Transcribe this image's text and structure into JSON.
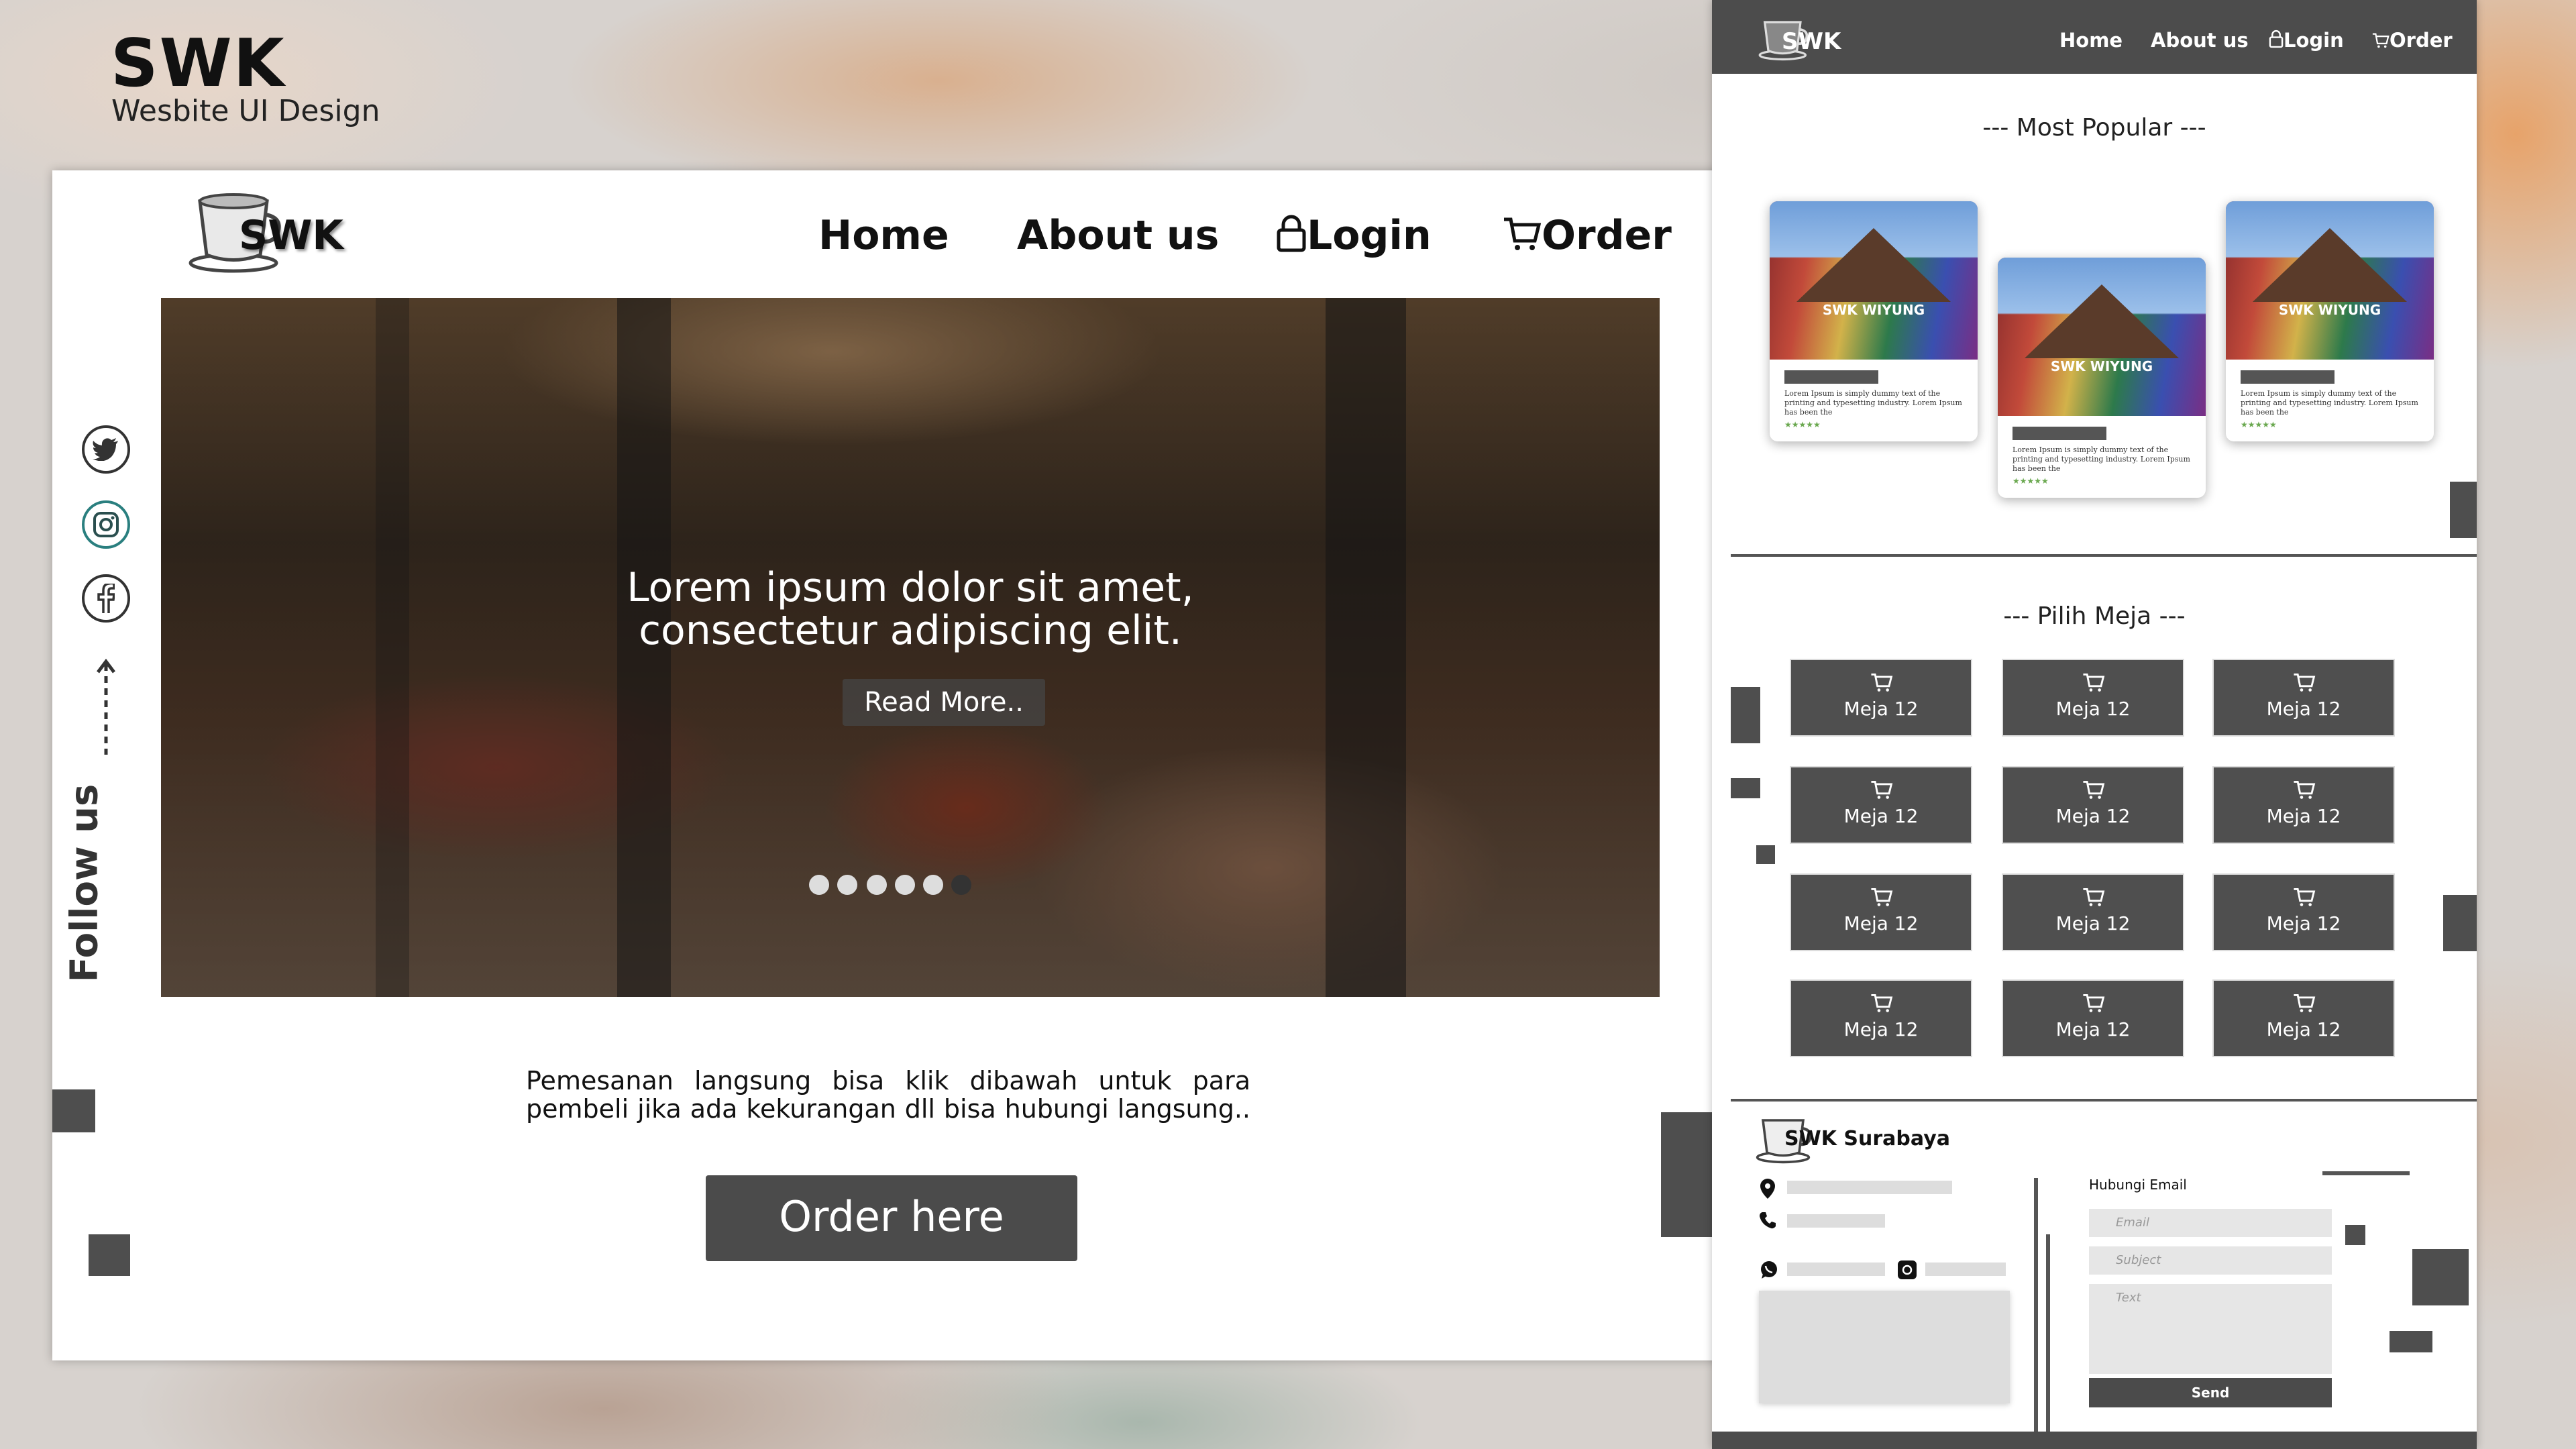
{
  "heading": {
    "title": "SWK",
    "subtitle": "Wesbite UI Design"
  },
  "left": {
    "logo_text": "SWK",
    "nav": {
      "home": "Home",
      "about": "About us",
      "login": "Login",
      "order": "Order"
    },
    "hero": {
      "text": "Lorem ipsum dolor sit amet,\nconsectetur adipiscing elit.",
      "button": "Read More..",
      "dots_count": 6,
      "active_dot": 6
    },
    "follow": "Follow us",
    "social_icons": [
      "twitter-icon",
      "instagram-icon",
      "facebook-icon"
    ],
    "description": "Pemesanan langsung bisa klik dibawah untuk para pembeli jika ada kekurangan dll bisa hubungi langsung..",
    "order_button": "Order here"
  },
  "right": {
    "logo_text": "SWK",
    "nav": {
      "home": "Home",
      "about": "About us",
      "login": "Login",
      "order": "Order"
    },
    "popular_title": "--- Most Popular ---",
    "cards": [
      {
        "image_label": "SWK WIYUNG",
        "text": "Lorem Ipsum is simply dummy text of the printing and typesetting industry. Lorem Ipsum has been the",
        "stars": "★★★★★"
      },
      {
        "image_label": "SWK WIYUNG",
        "text": "Lorem Ipsum is simply dummy text of the printing and typesetting industry. Lorem Ipsum has been the",
        "stars": "★★★★★"
      },
      {
        "image_label": "SWK WIYUNG",
        "text": "Lorem Ipsum is simply dummy text of the printing and typesetting industry. Lorem Ipsum has been the",
        "stars": "★★★★★"
      }
    ],
    "meja_title": "--- Pilih Meja ---",
    "meja_label": "Meja 12",
    "footer": {
      "logo_text": "SWK Surabaya",
      "email_heading": "Hubungi Email",
      "email_placeholder": "Email",
      "subject_placeholder": "Subject",
      "text_placeholder": "Text",
      "send": "Send"
    }
  },
  "colors": {
    "dark_gray": "#4b4b4b",
    "white": "#ffffff",
    "accent_star": "#6aa84f"
  }
}
